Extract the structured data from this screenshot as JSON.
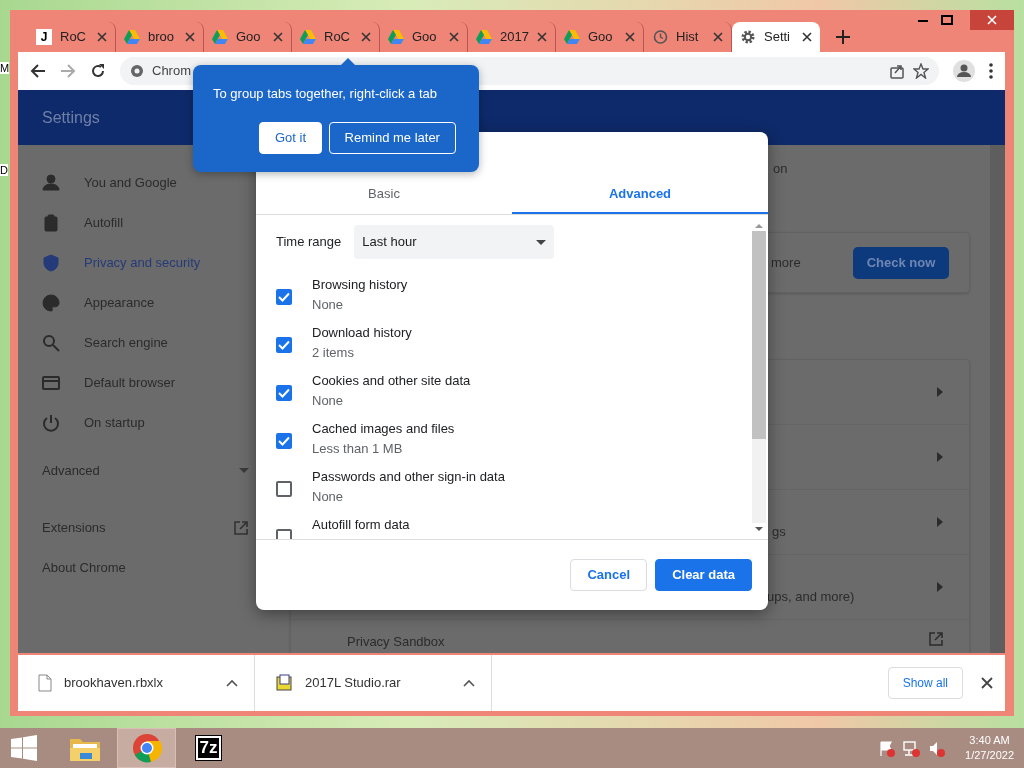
{
  "desktop_edge_labels": [
    "M",
    "D"
  ],
  "tabs": [
    {
      "label": "RoC",
      "kind": "letter",
      "icon_text": "J",
      "selected": false
    },
    {
      "label": "broo",
      "kind": "drive",
      "selected": false
    },
    {
      "label": "Goo",
      "kind": "drive",
      "selected": false
    },
    {
      "label": "RoC",
      "kind": "drive",
      "selected": false
    },
    {
      "label": "Goo",
      "kind": "drive",
      "selected": false
    },
    {
      "label": "2017",
      "kind": "drive",
      "selected": false
    },
    {
      "label": "Goo",
      "kind": "drive",
      "selected": false
    },
    {
      "label": "Hist",
      "kind": "history",
      "selected": false
    },
    {
      "label": "Setti",
      "kind": "gear",
      "selected": true
    }
  ],
  "address_bar": {
    "text": "Chrom"
  },
  "settings": {
    "title": "Settings",
    "sidebar": {
      "items": [
        {
          "label": "You and Google",
          "kind": "person",
          "selected": false
        },
        {
          "label": "Autofill",
          "kind": "clipboard",
          "selected": false
        },
        {
          "label": "Privacy and security",
          "kind": "shield",
          "selected": true
        },
        {
          "label": "Appearance",
          "kind": "palette",
          "selected": false
        },
        {
          "label": "Search engine",
          "kind": "search",
          "selected": false
        },
        {
          "label": "Default browser",
          "kind": "browser",
          "selected": false
        },
        {
          "label": "On startup",
          "kind": "power",
          "selected": false
        }
      ],
      "advanced": {
        "label": "Advanced",
        "expanded": false
      },
      "links": [
        {
          "label": "Extensions",
          "external": true
        },
        {
          "label": "About Chrome",
          "external": false
        }
      ]
    },
    "main": {
      "top_fragment": "on",
      "card_fragment": "more",
      "check_button": "Check now",
      "rows": [
        {
          "kind": "chevron"
        },
        {
          "kind": "chevron"
        },
        {
          "text": "gs",
          "kind": "chevron"
        },
        {
          "text": "ups, and more)",
          "kind": "chevron"
        },
        {
          "text": "Privacy Sandbox",
          "kind": "external"
        }
      ]
    }
  },
  "dialog": {
    "tabs": [
      {
        "label": "Basic",
        "selected": false
      },
      {
        "label": "Advanced",
        "selected": true
      }
    ],
    "time_range": {
      "label": "Time range",
      "value": "Last hour"
    },
    "items": [
      {
        "label": "Browsing history",
        "detail": "None",
        "checked": true
      },
      {
        "label": "Download history",
        "detail": "2 items",
        "checked": true
      },
      {
        "label": "Cookies and other site data",
        "detail": "None",
        "checked": true
      },
      {
        "label": "Cached images and files",
        "detail": "Less than 1 MB",
        "checked": true
      },
      {
        "label": "Passwords and other sign-in data",
        "detail": "None",
        "checked": false
      },
      {
        "label": "Autofill form data",
        "checked": false
      }
    ],
    "buttons": [
      {
        "label": "Cancel",
        "kind": "secondary"
      },
      {
        "label": "Clear data",
        "kind": "primary"
      }
    ]
  },
  "bubble": {
    "text": "To group tabs together, right-click a tab",
    "buttons": [
      {
        "label": "Got it",
        "kind": "filled"
      },
      {
        "label": "Remind me later",
        "kind": "outline"
      }
    ]
  },
  "downloads": {
    "items": [
      {
        "file": "brookhaven.rbxlx",
        "kind": "file"
      },
      {
        "file": "2017L Studio.rar",
        "kind": "archive"
      }
    ],
    "show_all": "Show all"
  },
  "taskbar": {
    "apps": [
      {
        "kind": "folder",
        "selected": false
      },
      {
        "kind": "chrome",
        "selected": true
      },
      {
        "kind": "sevenzip",
        "label": "7z",
        "selected": false
      }
    ],
    "clock": {
      "time": "3:40 AM",
      "date": "1/27/2022"
    }
  }
}
